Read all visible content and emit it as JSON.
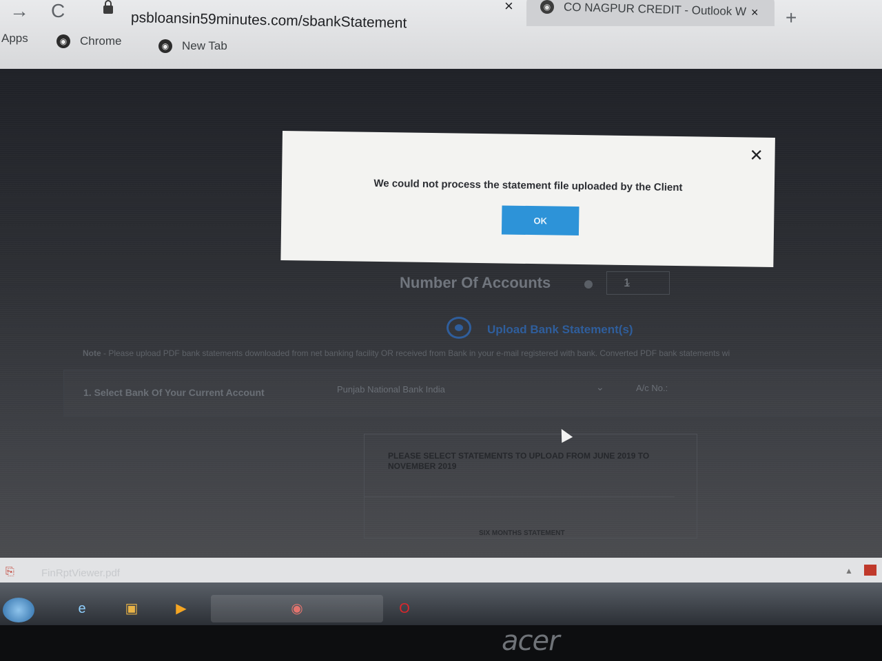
{
  "browser": {
    "url": "psbloansin59minutes.com/sbankStatement",
    "tab_title": "CO NAGPUR CREDIT - Outlook W",
    "icons": {
      "back": "→",
      "reload": "C",
      "tab_close": "×",
      "prev_tab_close": "×",
      "new_tab": "+"
    },
    "bookmarks": [
      "Apps",
      "Chrome",
      "New Tab"
    ]
  },
  "modal": {
    "message": "We could not process the statement file uploaded by the Client",
    "ok_label": "OK",
    "close_icon": "✕"
  },
  "page": {
    "number_of_accounts_label": "Number Of Accounts",
    "number_of_accounts_value": "1",
    "upload_label": "Upload Bank Statement(s)",
    "note_prefix": "Note",
    "note": " - Please upload PDF bank statements downloaded from net banking facility OR received from Bank in your e-mail registered with bank. Converted PDF bank statements wi",
    "select_bank_label": "1. Select Bank Of Your Current Account",
    "selected_bank": "Punjab National Bank India",
    "account_no_label": "A/c No.:",
    "statement_instruction": "PLEASE SELECT STATEMENTS TO UPLOAD FROM JUNE 2019 TO NOVEMBER 2019",
    "statement_sub": "SIX MONTHS STATEMENT"
  },
  "downloads": {
    "file": "FinRptViewer.pdf"
  },
  "device": {
    "brand": "acer"
  }
}
